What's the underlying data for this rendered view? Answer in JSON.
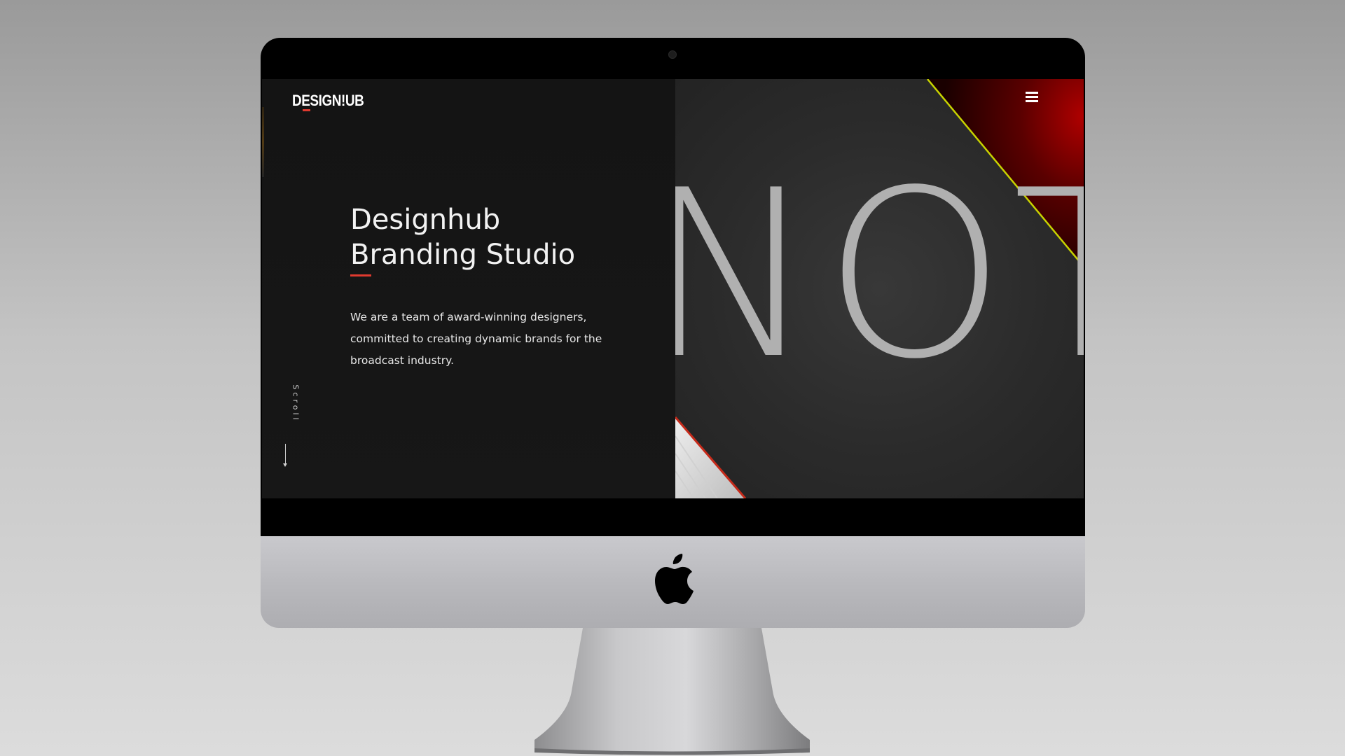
{
  "site": {
    "logo_text": "DESIGN!UB",
    "menu_icon": "hamburger-menu-icon"
  },
  "hero": {
    "title_line1": "Designhub",
    "title_line2": "Branding Studio",
    "description": "We are a team of award-winning designers, committed to creating dynamic brands for the broadcast industry.",
    "scroll_label": "Scroll",
    "big_word": "NOT"
  },
  "colors": {
    "accent": "#e03a2f",
    "background_dark": "#151515",
    "panel_gray": "#2b2b2b",
    "highlight_red": "#a00000",
    "highlight_yellow": "#c8d400"
  },
  "device": {
    "logo_icon": "apple-logo-icon"
  }
}
